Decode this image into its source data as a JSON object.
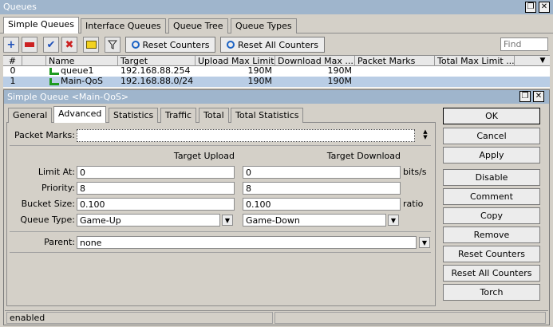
{
  "window": {
    "title": "Queues",
    "restore_glyph": "❐",
    "close_glyph": "✕"
  },
  "main_tabs": [
    "Simple Queues",
    "Interface Queues",
    "Queue Tree",
    "Queue Types"
  ],
  "toolbar": {
    "add_glyph": "+",
    "remove_glyph": "−",
    "enable_glyph": "✔",
    "disable_glyph": "✖",
    "reset_counters": "Reset Counters",
    "reset_all_counters": "Reset All Counters",
    "find_placeholder": "Find"
  },
  "table": {
    "columns": [
      "#",
      "Name",
      "Target",
      "Upload Max Limit",
      "Download Max ...",
      "Packet Marks",
      "Total Max Limit ..."
    ],
    "rows": [
      {
        "num": "0",
        "name": "queue1",
        "target": "192.168.88.254",
        "upload": "190M",
        "download": "190M",
        "marks": "",
        "total": ""
      },
      {
        "num": "1",
        "name": "Main-QoS",
        "target": "192.168.88.0/24",
        "upload": "190M",
        "download": "190M",
        "marks": "",
        "total": ""
      }
    ]
  },
  "dialog": {
    "title": "Simple Queue <Main-QoS>",
    "tabs": [
      "General",
      "Advanced",
      "Statistics",
      "Traffic",
      "Total",
      "Total Statistics"
    ],
    "packet_marks_label": "Packet Marks:",
    "packet_marks_value": "",
    "target_upload_header": "Target Upload",
    "target_download_header": "Target Download",
    "fields": {
      "limit_at": {
        "label": "Limit At:",
        "upload": "0",
        "download": "0",
        "unit": "bits/s"
      },
      "priority": {
        "label": "Priority:",
        "upload": "8",
        "download": "8",
        "unit": ""
      },
      "bucket_size": {
        "label": "Bucket Size:",
        "upload": "0.100",
        "download": "0.100",
        "unit": "ratio"
      },
      "queue_type": {
        "label": "Queue Type:",
        "upload": "Game-Up",
        "download": "Game-Down",
        "unit": ""
      }
    },
    "parent_label": "Parent:",
    "parent_value": "none",
    "buttons": [
      "OK",
      "Cancel",
      "Apply",
      "Disable",
      "Comment",
      "Copy",
      "Remove",
      "Reset Counters",
      "Reset All Counters",
      "Torch"
    ],
    "status": "enabled"
  },
  "colors": {
    "titlebar": "#9fb5cc",
    "selection": "#b9cde5",
    "queue_icon": "#1e9a1e"
  },
  "icons": [
    "plus-icon",
    "minus-icon",
    "check-icon",
    "cross-icon",
    "comment-icon",
    "filter-icon",
    "reset-icon",
    "queue-icon"
  ]
}
